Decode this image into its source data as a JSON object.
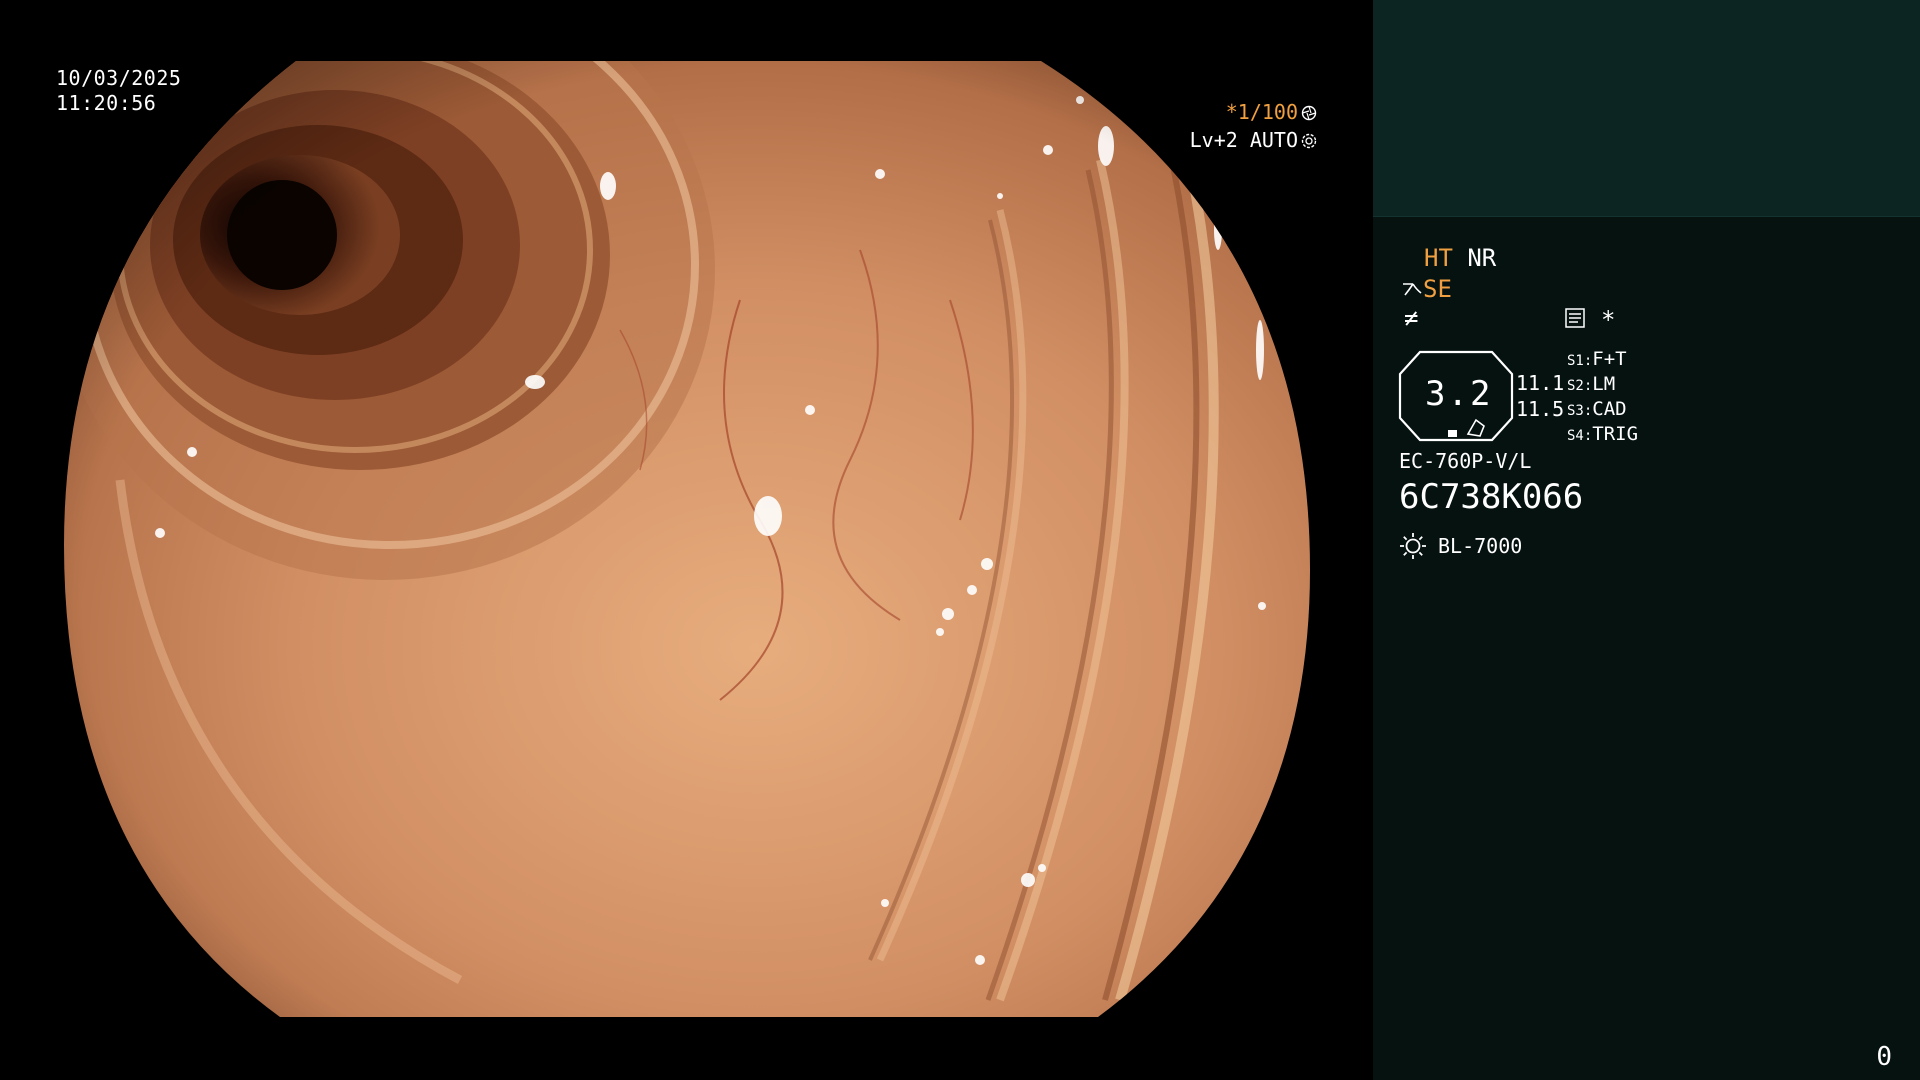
{
  "viewer": {
    "date": "10/03/2025",
    "time": "11:20:56",
    "shutter_prefix": "*",
    "shutter_value": "1/100",
    "level_text": "Lv+2 AUTO"
  },
  "panel": {
    "mode_ht": "HT",
    "mode_nr": "NR",
    "mode_se": "SE",
    "f_symbol": "≠",
    "asterisk": "*",
    "gauge_value": "3.2",
    "reading_1": "11.1",
    "reading_2": "11.5",
    "switches": [
      {
        "key": "S1:",
        "value": "F+T"
      },
      {
        "key": "S2:",
        "value": "LM"
      },
      {
        "key": "S3:",
        "value": "CAD"
      },
      {
        "key": "S4:",
        "value": "TRIG"
      }
    ],
    "scope_model": "EC-760P-V/L",
    "scope_serial": "6C738K066",
    "light_source": "BL-7000",
    "counter": "0"
  },
  "icons": {
    "shutter_icon": "aperture-icon",
    "level_icon": "gear-icon",
    "se_icon": "enhance-wave-icon",
    "memo_icon": "memo-icon",
    "lamp_icon": "lamp-icon"
  },
  "colors": {
    "accent_orange": "#f0a040",
    "panel_bg": "#051210",
    "panel_header_bg": "#0c2523"
  }
}
